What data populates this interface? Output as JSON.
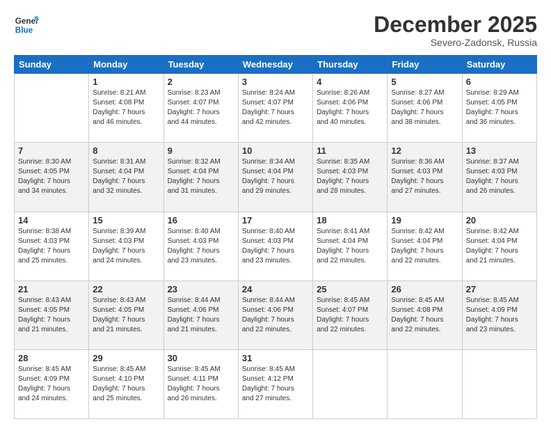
{
  "logo": {
    "line1": "General",
    "line2": "Blue"
  },
  "title": "December 2025",
  "location": "Severo-Zadonsk, Russia",
  "weekdays": [
    "Sunday",
    "Monday",
    "Tuesday",
    "Wednesday",
    "Thursday",
    "Friday",
    "Saturday"
  ],
  "weeks": [
    [
      {
        "day": "",
        "info": ""
      },
      {
        "day": "1",
        "info": "Sunrise: 8:21 AM\nSunset: 4:08 PM\nDaylight: 7 hours\nand 46 minutes."
      },
      {
        "day": "2",
        "info": "Sunrise: 8:23 AM\nSunset: 4:07 PM\nDaylight: 7 hours\nand 44 minutes."
      },
      {
        "day": "3",
        "info": "Sunrise: 8:24 AM\nSunset: 4:07 PM\nDaylight: 7 hours\nand 42 minutes."
      },
      {
        "day": "4",
        "info": "Sunrise: 8:26 AM\nSunset: 4:06 PM\nDaylight: 7 hours\nand 40 minutes."
      },
      {
        "day": "5",
        "info": "Sunrise: 8:27 AM\nSunset: 4:06 PM\nDaylight: 7 hours\nand 38 minutes."
      },
      {
        "day": "6",
        "info": "Sunrise: 8:29 AM\nSunset: 4:05 PM\nDaylight: 7 hours\nand 36 minutes."
      }
    ],
    [
      {
        "day": "7",
        "info": "Sunrise: 8:30 AM\nSunset: 4:05 PM\nDaylight: 7 hours\nand 34 minutes."
      },
      {
        "day": "8",
        "info": "Sunrise: 8:31 AM\nSunset: 4:04 PM\nDaylight: 7 hours\nand 32 minutes."
      },
      {
        "day": "9",
        "info": "Sunrise: 8:32 AM\nSunset: 4:04 PM\nDaylight: 7 hours\nand 31 minutes."
      },
      {
        "day": "10",
        "info": "Sunrise: 8:34 AM\nSunset: 4:04 PM\nDaylight: 7 hours\nand 29 minutes."
      },
      {
        "day": "11",
        "info": "Sunrise: 8:35 AM\nSunset: 4:03 PM\nDaylight: 7 hours\nand 28 minutes."
      },
      {
        "day": "12",
        "info": "Sunrise: 8:36 AM\nSunset: 4:03 PM\nDaylight: 7 hours\nand 27 minutes."
      },
      {
        "day": "13",
        "info": "Sunrise: 8:37 AM\nSunset: 4:03 PM\nDaylight: 7 hours\nand 26 minutes."
      }
    ],
    [
      {
        "day": "14",
        "info": "Sunrise: 8:38 AM\nSunset: 4:03 PM\nDaylight: 7 hours\nand 25 minutes."
      },
      {
        "day": "15",
        "info": "Sunrise: 8:39 AM\nSunset: 4:03 PM\nDaylight: 7 hours\nand 24 minutes."
      },
      {
        "day": "16",
        "info": "Sunrise: 8:40 AM\nSunset: 4:03 PM\nDaylight: 7 hours\nand 23 minutes."
      },
      {
        "day": "17",
        "info": "Sunrise: 8:40 AM\nSunset: 4:03 PM\nDaylight: 7 hours\nand 23 minutes."
      },
      {
        "day": "18",
        "info": "Sunrise: 8:41 AM\nSunset: 4:04 PM\nDaylight: 7 hours\nand 22 minutes."
      },
      {
        "day": "19",
        "info": "Sunrise: 8:42 AM\nSunset: 4:04 PM\nDaylight: 7 hours\nand 22 minutes."
      },
      {
        "day": "20",
        "info": "Sunrise: 8:42 AM\nSunset: 4:04 PM\nDaylight: 7 hours\nand 21 minutes."
      }
    ],
    [
      {
        "day": "21",
        "info": "Sunrise: 8:43 AM\nSunset: 4:05 PM\nDaylight: 7 hours\nand 21 minutes."
      },
      {
        "day": "22",
        "info": "Sunrise: 8:43 AM\nSunset: 4:05 PM\nDaylight: 7 hours\nand 21 minutes."
      },
      {
        "day": "23",
        "info": "Sunrise: 8:44 AM\nSunset: 4:06 PM\nDaylight: 7 hours\nand 21 minutes."
      },
      {
        "day": "24",
        "info": "Sunrise: 8:44 AM\nSunset: 4:06 PM\nDaylight: 7 hours\nand 22 minutes."
      },
      {
        "day": "25",
        "info": "Sunrise: 8:45 AM\nSunset: 4:07 PM\nDaylight: 7 hours\nand 22 minutes."
      },
      {
        "day": "26",
        "info": "Sunrise: 8:45 AM\nSunset: 4:08 PM\nDaylight: 7 hours\nand 22 minutes."
      },
      {
        "day": "27",
        "info": "Sunrise: 8:45 AM\nSunset: 4:09 PM\nDaylight: 7 hours\nand 23 minutes."
      }
    ],
    [
      {
        "day": "28",
        "info": "Sunrise: 8:45 AM\nSunset: 4:09 PM\nDaylight: 7 hours\nand 24 minutes."
      },
      {
        "day": "29",
        "info": "Sunrise: 8:45 AM\nSunset: 4:10 PM\nDaylight: 7 hours\nand 25 minutes."
      },
      {
        "day": "30",
        "info": "Sunrise: 8:45 AM\nSunset: 4:11 PM\nDaylight: 7 hours\nand 26 minutes."
      },
      {
        "day": "31",
        "info": "Sunrise: 8:45 AM\nSunset: 4:12 PM\nDaylight: 7 hours\nand 27 minutes."
      },
      {
        "day": "",
        "info": ""
      },
      {
        "day": "",
        "info": ""
      },
      {
        "day": "",
        "info": ""
      }
    ]
  ]
}
